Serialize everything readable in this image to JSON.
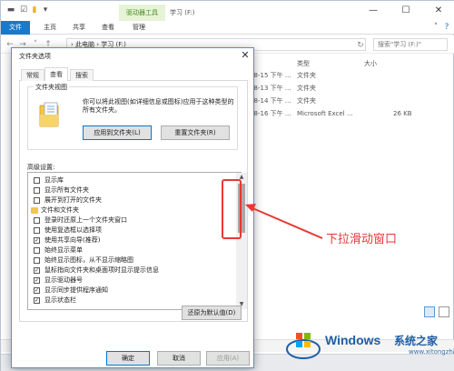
{
  "explorer": {
    "ribbon_context_tab": "驱动器工具",
    "window_title": "学习 (F:)",
    "ribbon_tabs": [
      "文件",
      "主页",
      "共享",
      "查看",
      "管理"
    ],
    "address_path": "› 此电脑 › 学习 (F:)",
    "search_placeholder": "搜索\"学习 (F:)\"",
    "columns": {
      "date": "日期",
      "type": "类型",
      "size": "大小"
    },
    "rows": [
      {
        "date": "-8-15 下午 ...",
        "type": "文件夹",
        "size": ""
      },
      {
        "date": "-8-13 下午 ...",
        "type": "文件夹",
        "size": ""
      },
      {
        "date": "-8-14 下午 ...",
        "type": "文件夹",
        "size": ""
      },
      {
        "date": "-8-16 下午 ...",
        "type": "Microsoft Excel ...",
        "size": "26 KB"
      }
    ]
  },
  "dialog": {
    "title": "文件夹选项",
    "tabs": [
      "常规",
      "查看",
      "搜索"
    ],
    "active_tab": "查看",
    "folder_views": {
      "label": "文件夹视图",
      "description": "你可以将此视图(如详细信息或图标)应用于这种类型的所有文件夹。",
      "apply_button": "应用到文件夹(L)",
      "reset_button": "重置文件夹(R)"
    },
    "advanced_label": "高级设置:",
    "settings": [
      {
        "label": "显示库",
        "checked": false,
        "kind": "check"
      },
      {
        "label": "显示所有文件夹",
        "checked": false,
        "kind": "check"
      },
      {
        "label": "展开到打开的文件夹",
        "checked": false,
        "kind": "check"
      },
      {
        "label": "文件和文件夹",
        "checked": false,
        "kind": "group"
      },
      {
        "label": "登录时还原上一个文件夹窗口",
        "checked": false,
        "kind": "check"
      },
      {
        "label": "使用复选框以选择项",
        "checked": false,
        "kind": "check"
      },
      {
        "label": "使用共享向导(推荐)",
        "checked": true,
        "kind": "check"
      },
      {
        "label": "始终显示菜单",
        "checked": false,
        "kind": "check"
      },
      {
        "label": "始终显示图标，从不显示缩略图",
        "checked": false,
        "kind": "check"
      },
      {
        "label": "鼠标指向文件夹和桌面项时显示提示信息",
        "checked": true,
        "kind": "check"
      },
      {
        "label": "显示驱动器号",
        "checked": true,
        "kind": "check"
      },
      {
        "label": "显示同步提供程序通知",
        "checked": true,
        "kind": "check"
      },
      {
        "label": "显示状态栏",
        "checked": true,
        "kind": "check"
      }
    ],
    "restore_defaults": "还原为默认值(D)",
    "ok": "确定",
    "cancel": "取消",
    "apply": "应用(A)"
  },
  "annotation": {
    "text": "下拉滑动窗口",
    "color": "#e53935"
  },
  "watermark": {
    "brand": "Windows",
    "cn": "系统之家",
    "url": "www.xitongzhijia.net"
  },
  "colors": {
    "accent": "#1979ca",
    "context_tab": "#4b8b22",
    "dialog_border": "#5b8ccd"
  }
}
